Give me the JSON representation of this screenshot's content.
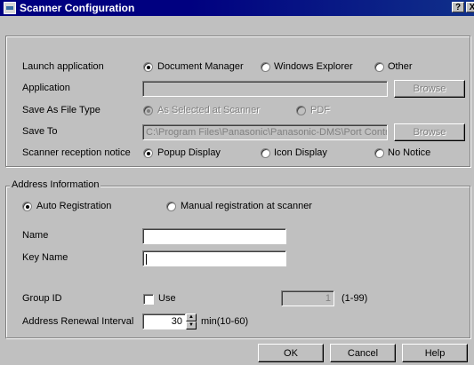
{
  "window": {
    "title": "Scanner Configuration",
    "help_btn": "?",
    "close_btn": "X"
  },
  "launch": {
    "label": "Launch application",
    "options": [
      "Document Manager",
      "Windows Explorer",
      "Other"
    ],
    "selected": "Document Manager"
  },
  "application": {
    "label": "Application",
    "value": "",
    "browse": "Browse"
  },
  "save_as": {
    "label": "Save As File Type",
    "options": [
      "As Selected at Scanner",
      "PDF"
    ],
    "selected": "As Selected at Scanner"
  },
  "save_to": {
    "label": "Save To",
    "value": "C:\\Program Files\\Panasonic\\Panasonic-DMS\\Port Controll",
    "browse": "Browse"
  },
  "reception": {
    "label": "Scanner reception notice",
    "options": [
      "Popup Display",
      "Icon Display",
      "No Notice"
    ],
    "selected": "Popup Display"
  },
  "address": {
    "group_label": "Address Information",
    "reg_options": [
      "Auto Registration",
      "Manual registration at scanner"
    ],
    "selected": "Auto Registration",
    "name_label": "Name",
    "name_value": "",
    "keyname_label": "Key Name",
    "keyname_value": "",
    "group_id_label": "Group ID",
    "use_label": "Use",
    "group_id_value": "1",
    "group_id_range": "(1-99)",
    "renewal_label": "Address Renewal Interval",
    "renewal_value": "30",
    "renewal_unit": "min(10-60)"
  },
  "buttons": {
    "ok": "OK",
    "cancel": "Cancel",
    "help": "Help"
  }
}
